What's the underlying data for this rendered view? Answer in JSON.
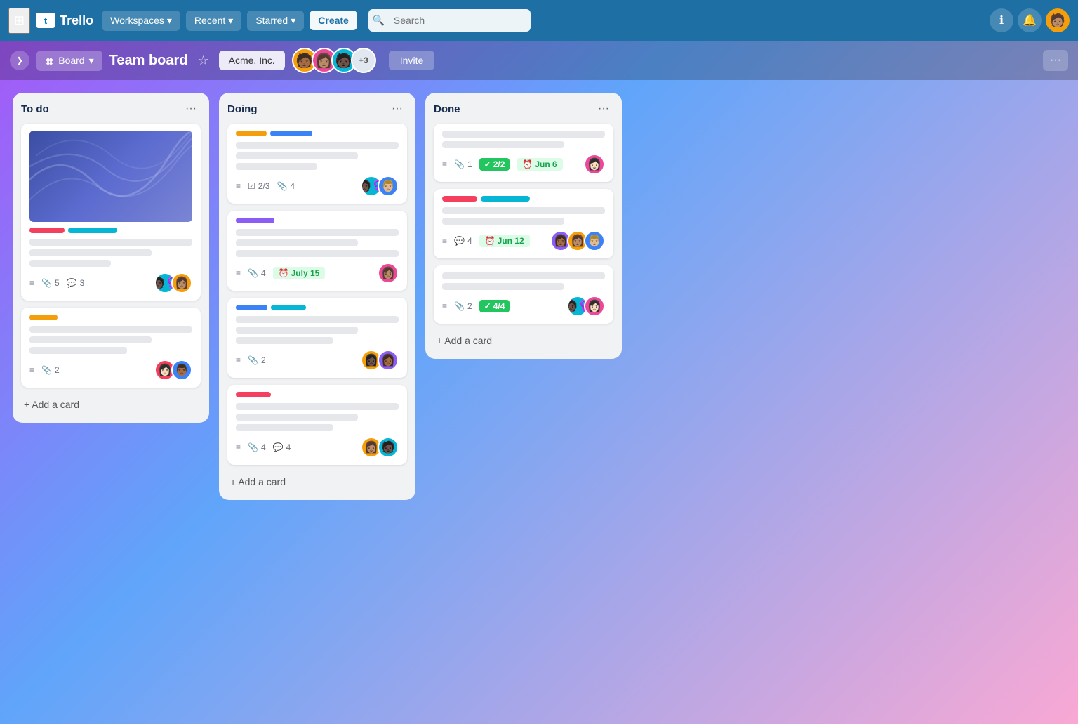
{
  "app": {
    "name": "Trello",
    "logo_char": "t"
  },
  "navbar": {
    "grid_icon": "⊞",
    "workspaces_label": "Workspaces",
    "recent_label": "Recent",
    "starred_label": "Starred",
    "create_label": "Create",
    "search_placeholder": "Search",
    "info_icon": "ℹ",
    "bell_icon": "🔔",
    "chevron": "▾"
  },
  "board_header": {
    "collapse_icon": "❯",
    "view_icon": "▦",
    "view_label": "Board",
    "board_title": "Team board",
    "star_icon": "☆",
    "workspace_label": "Acme, Inc.",
    "members_extra": "+3",
    "invite_label": "Invite",
    "more_icon": "···"
  },
  "columns": [
    {
      "id": "todo",
      "title": "To do",
      "menu_icon": "···",
      "cards": [
        {
          "id": "todo-1",
          "has_image": true,
          "labels": [
            "pink",
            "cyan"
          ],
          "text_lines": [
            "full",
            "3q",
            "half"
          ],
          "footer": {
            "desc_icon": "≡",
            "clip_icon": "📎",
            "clip_count": "5",
            "comment_icon": "💬",
            "comment_count": "3",
            "avatars": [
              "🧑🏿‍♀️",
              "👩🏽‍🦱"
            ]
          }
        },
        {
          "id": "todo-2",
          "has_image": false,
          "labels": [
            "yellow"
          ],
          "text_lines": [
            "full",
            "3q",
            "2q"
          ],
          "footer": {
            "desc_icon": "≡",
            "clip_icon": "📎",
            "clip_count": "2",
            "avatars": [
              "👩🏻‍🦰",
              "👨🏾"
            ]
          }
        }
      ],
      "add_card_label": "+ Add a card"
    },
    {
      "id": "doing",
      "title": "Doing",
      "menu_icon": "···",
      "cards": [
        {
          "id": "doing-1",
          "has_image": false,
          "labels": [
            "yellow",
            "blue"
          ],
          "text_lines": [
            "full",
            "3q",
            "half"
          ],
          "footer": {
            "desc_icon": "≡",
            "check_icon": "☑",
            "check_label": "2/3",
            "clip_icon": "📎",
            "clip_count": "4",
            "avatars": [
              "🧑🏿‍♀️",
              "👨🏼"
            ]
          }
        },
        {
          "id": "doing-2",
          "has_image": false,
          "labels": [
            "purple"
          ],
          "text_lines": [
            "full",
            "3q",
            "full"
          ],
          "footer": {
            "desc_icon": "≡",
            "clip_icon": "📎",
            "clip_count": "4",
            "date_icon": "⏰",
            "date_label": "July 15",
            "avatars": [
              "👩🏽‍🦱"
            ]
          }
        },
        {
          "id": "doing-3",
          "has_image": false,
          "labels": [
            "blue",
            "cyan"
          ],
          "text_lines": [
            "full",
            "3q",
            "2q"
          ],
          "footer": {
            "desc_icon": "≡",
            "clip_icon": "📎",
            "clip_count": "2",
            "avatars": [
              "👩🏿",
              "👩🏾‍🦱"
            ]
          }
        },
        {
          "id": "doing-4",
          "has_image": false,
          "labels": [
            "pink"
          ],
          "text_lines": [
            "full",
            "3q",
            "2q"
          ],
          "footer": {
            "desc_icon": "≡",
            "clip_icon": "📎",
            "clip_count": "4",
            "comment_icon": "💬",
            "comment_count": "4",
            "avatars": [
              "👩🏽",
              "🧑🏿"
            ]
          }
        }
      ],
      "add_card_label": "+ Add a card"
    },
    {
      "id": "done",
      "title": "Done",
      "menu_icon": "···",
      "cards": [
        {
          "id": "done-1",
          "has_image": false,
          "labels": [],
          "text_lines": [
            "full",
            "3q"
          ],
          "footer": {
            "desc_icon": "≡",
            "clip_icon": "📎",
            "clip_count": "1",
            "check_badge": "2/2",
            "date_badge": "Jun 6",
            "avatars": [
              "👩🏻‍🦱"
            ]
          }
        },
        {
          "id": "done-2",
          "has_image": false,
          "labels": [
            "pink",
            "cyan"
          ],
          "text_lines": [
            "full",
            "3q"
          ],
          "footer": {
            "desc_icon": "≡",
            "comment_icon": "💬",
            "comment_count": "4",
            "date_badge": "Jun 12",
            "avatars": [
              "👩🏾",
              "👩🏽‍🦰",
              "👨🏼"
            ]
          }
        },
        {
          "id": "done-3",
          "has_image": false,
          "labels": [],
          "text_lines": [
            "full",
            "3q"
          ],
          "footer": {
            "desc_icon": "≡",
            "clip_icon": "📎",
            "clip_count": "2",
            "check_badge": "4/4",
            "avatars": [
              "🧑🏿‍♀️",
              "👩🏻‍🦱"
            ]
          }
        }
      ],
      "add_card_label": "+ Add a card"
    }
  ],
  "colors": {
    "navbar_bg": "#1d6fa4",
    "accent": "#0079bf"
  }
}
